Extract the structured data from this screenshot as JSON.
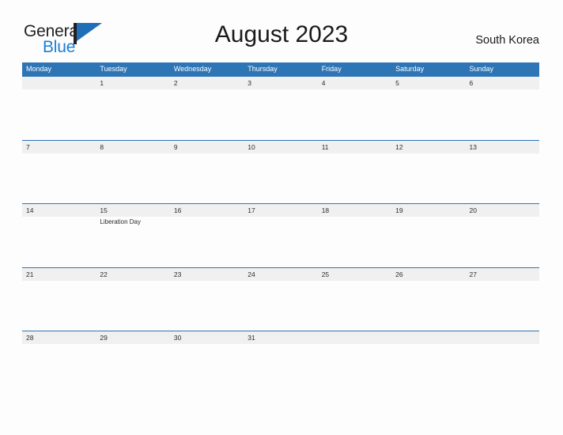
{
  "brand": {
    "name_part1": "General",
    "name_part2": "Blue",
    "flag_icon": "flag-triangle-icon",
    "accent_color": "#1e6eb8",
    "text_color": "#231f20"
  },
  "header": {
    "title": "August 2023",
    "locale": "South Korea"
  },
  "calendar": {
    "header_bg_color": "#2e75b6",
    "band_bg_color": "#f0f0f0",
    "row_border_color": "#2e75b6",
    "weekdays": [
      "Monday",
      "Tuesday",
      "Wednesday",
      "Thursday",
      "Friday",
      "Saturday",
      "Sunday"
    ],
    "weeks": [
      [
        {
          "day": "",
          "event": ""
        },
        {
          "day": "1",
          "event": ""
        },
        {
          "day": "2",
          "event": ""
        },
        {
          "day": "3",
          "event": ""
        },
        {
          "day": "4",
          "event": ""
        },
        {
          "day": "5",
          "event": ""
        },
        {
          "day": "6",
          "event": ""
        }
      ],
      [
        {
          "day": "7",
          "event": ""
        },
        {
          "day": "8",
          "event": ""
        },
        {
          "day": "9",
          "event": ""
        },
        {
          "day": "10",
          "event": ""
        },
        {
          "day": "11",
          "event": ""
        },
        {
          "day": "12",
          "event": ""
        },
        {
          "day": "13",
          "event": ""
        }
      ],
      [
        {
          "day": "14",
          "event": ""
        },
        {
          "day": "15",
          "event": "Liberation Day"
        },
        {
          "day": "16",
          "event": ""
        },
        {
          "day": "17",
          "event": ""
        },
        {
          "day": "18",
          "event": ""
        },
        {
          "day": "19",
          "event": ""
        },
        {
          "day": "20",
          "event": ""
        }
      ],
      [
        {
          "day": "21",
          "event": ""
        },
        {
          "day": "22",
          "event": ""
        },
        {
          "day": "23",
          "event": ""
        },
        {
          "day": "24",
          "event": ""
        },
        {
          "day": "25",
          "event": ""
        },
        {
          "day": "26",
          "event": ""
        },
        {
          "day": "27",
          "event": ""
        }
      ],
      [
        {
          "day": "28",
          "event": ""
        },
        {
          "day": "29",
          "event": ""
        },
        {
          "day": "30",
          "event": ""
        },
        {
          "day": "31",
          "event": ""
        },
        {
          "day": "",
          "event": ""
        },
        {
          "day": "",
          "event": ""
        },
        {
          "day": "",
          "event": ""
        }
      ]
    ]
  }
}
